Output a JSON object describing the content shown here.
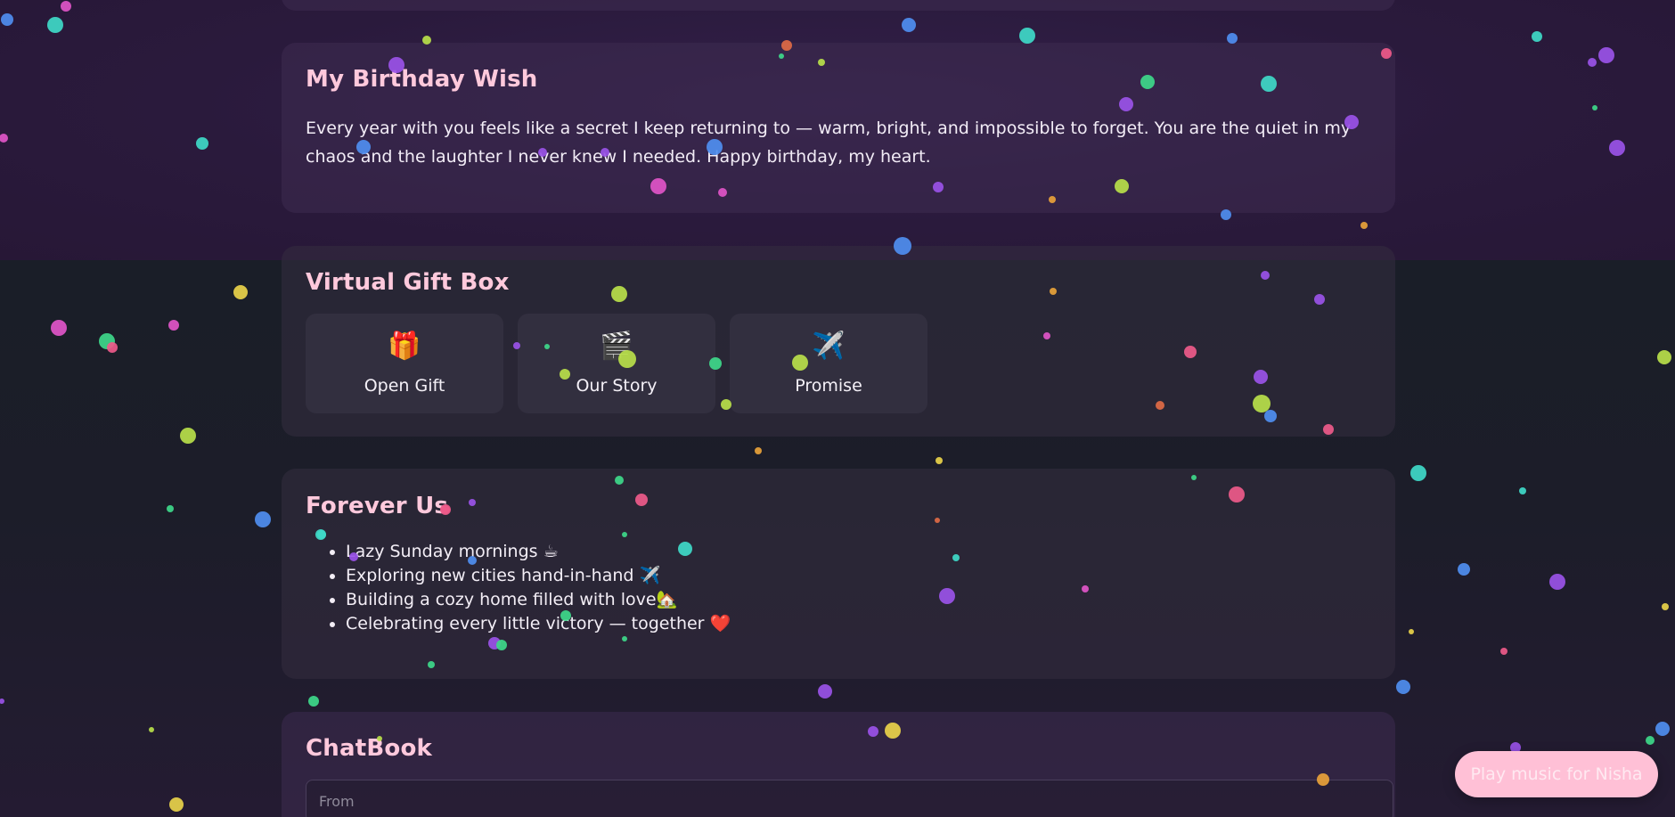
{
  "wish": {
    "title": "My Birthday Wish",
    "text": "Every year with you feels like a secret I keep returning to — warm, bright, and impossible to forget. You are the quiet in my chaos and the laughter I never knew I needed. Happy birthday, my heart."
  },
  "gift_box": {
    "title": "Virtual Gift Box",
    "items": [
      {
        "emoji": "🎁",
        "label": "Open Gift"
      },
      {
        "emoji": "🎬",
        "label": "Our Story"
      },
      {
        "emoji": "✈️",
        "label": "Promise"
      }
    ]
  },
  "forever": {
    "title": "Forever Us",
    "items": [
      "Lazy Sunday mornings ☕",
      "Exploring new cities hand-in-hand ✈️",
      "Building a cozy home filled with love🏡",
      "Celebrating every little victory — together ❤️"
    ]
  },
  "chatbook": {
    "title": "ChatBook",
    "from_placeholder": "From"
  },
  "music_button": {
    "label": "Play music for Nisha"
  },
  "colors": {
    "title_pink": "#ffc9dc",
    "button_pink": "#ffc0d6",
    "confetti": [
      "#4f8ef0",
      "#e055c8",
      "#3fd9c8",
      "#b8e04a",
      "#9a52e8",
      "#ee5a8a",
      "#e06a45",
      "#e9d24a",
      "#3ed88a",
      "#e8a23a"
    ]
  }
}
